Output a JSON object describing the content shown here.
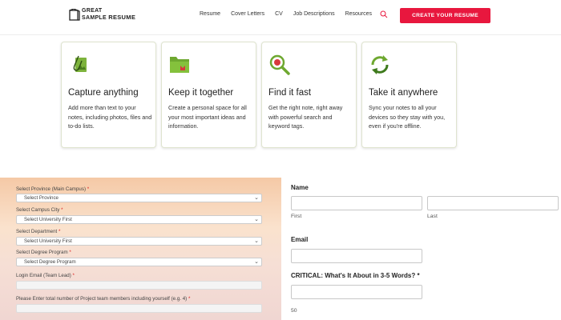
{
  "header": {
    "logo_line1": "GREAT",
    "logo_line2a": "SAMPLE",
    "logo_line2b": "RESUME",
    "nav": [
      "Resume",
      "Cover Letters",
      "CV",
      "Job Descriptions",
      "Resources"
    ],
    "cta_label": "CREATE YOUR RESUME",
    "accent_color": "#e8173e"
  },
  "cards": [
    {
      "icon": "paperclip-image-icon",
      "title": "Capture anything",
      "text": "Add more than text to your notes, including photos, files and to-do lists."
    },
    {
      "icon": "folder-icon",
      "title": "Keep it together",
      "text": "Create a personal space for all your most important ideas and information."
    },
    {
      "icon": "magnifier-icon",
      "title": "Find it fast",
      "text": "Get the right note, right away with powerful search and keyword tags."
    },
    {
      "icon": "sync-icon",
      "title": "Take it anywhere",
      "text": "Sync your notes to all your devices so they stay with you, even if you're offline."
    }
  ],
  "left_form": {
    "province_label": "Select Province (Main Campus)",
    "province_value": "Select Province",
    "city_label": "Select Campus City",
    "city_value": "Select University First",
    "department_label": "Select Department",
    "department_value": "Select University First",
    "program_label": "Select Degree Program",
    "program_value": "Select Degree Program",
    "email_label": "Login Email (Team Lead)",
    "members_label": "Please Enter total number of Project team members including yourself (e.g. 4)",
    "required_mark": "*"
  },
  "right_form": {
    "name_label": "Name",
    "first_label": "First",
    "last_label": "Last",
    "email_label": "Email",
    "critical_label": "CRITICAL: What's It About in 3-5 Words?",
    "required_mark": "*",
    "char_count": "50"
  }
}
